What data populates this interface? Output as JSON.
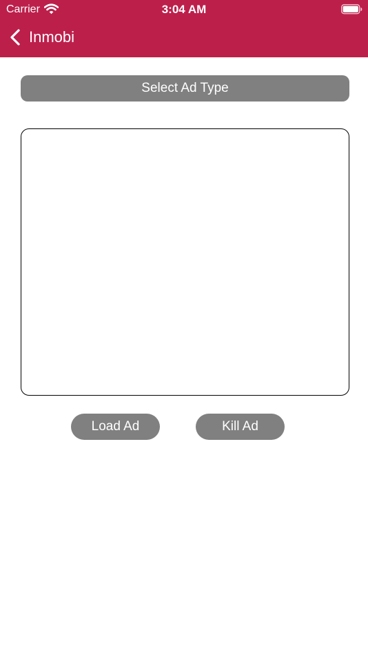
{
  "status_bar": {
    "carrier": "Carrier",
    "time": "3:04 AM"
  },
  "nav": {
    "back_label": "Inmobi"
  },
  "main": {
    "select_ad_type_label": "Select Ad Type",
    "load_ad_label": "Load Ad",
    "kill_ad_label": "Kill Ad"
  },
  "colors": {
    "header_background": "#bd1f4b",
    "button_background": "#808080"
  },
  "icons": {
    "wifi": "wifi-icon",
    "battery": "battery-icon",
    "back": "chevron-left-icon"
  }
}
